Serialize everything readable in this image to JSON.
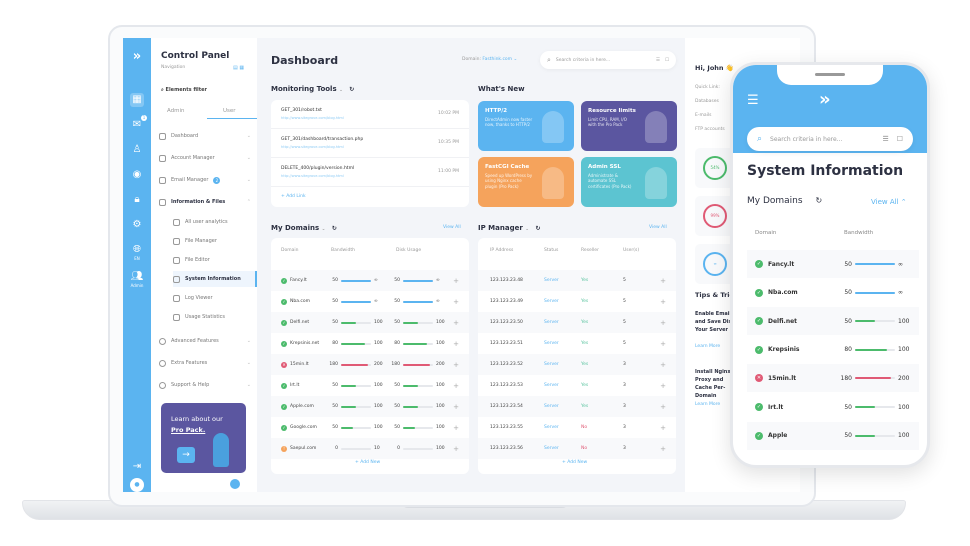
{
  "colors": {
    "accent": "#5bb4f0",
    "ok": "#4cbb6c",
    "error": "#e05a75",
    "warning": "#f5a35c",
    "purple": "#5b56a0"
  },
  "nav": {
    "title": "Control Panel",
    "subtitle": "Navigation",
    "filter": "Elements filter",
    "tabs": [
      "Admin",
      "User"
    ],
    "rail_labels": {
      "lang": "EN",
      "admin": "Admin"
    },
    "messages_badge": "1",
    "items": [
      {
        "label": "Dashboard",
        "icon": "dashboard-icon"
      },
      {
        "label": "Account Manager",
        "icon": "account-icon"
      },
      {
        "label": "Email Manager",
        "icon": "mail-icon",
        "badge": "2"
      },
      {
        "label": "Information & Files",
        "icon": "folder-icon"
      }
    ],
    "sub_items": [
      "All user analytics",
      "File Manager",
      "File Editor",
      "System Information",
      "Log Viewer",
      "Usage Statistics"
    ],
    "more_items": [
      "Advanced Features",
      "Extra Features",
      "Support & Help"
    ],
    "promo": {
      "line1": "Learn about our",
      "line2": "Pro Pack."
    }
  },
  "header": {
    "title": "Dashboard",
    "domain_label": "Domain:",
    "domain_value": "Fasthink.com",
    "search_placeholder": "Search criteria in here..."
  },
  "monitoring": {
    "title": "Monitoring Tools",
    "add_label": "Add Link",
    "items": [
      {
        "path": "GET_301/robot.txt",
        "url": "http://www.sitegrove.com/blog.html",
        "time": "10:02 PM"
      },
      {
        "path": "GET_301/dashboard/transaction.php",
        "url": "http://www.sitegrove.com/blog.html",
        "time": "10:35 PM"
      },
      {
        "path": "DELETE_400/plugin/version.html",
        "url": "http://www.sitegrove.com/blog.html",
        "time": "11:00 PM"
      }
    ]
  },
  "whats_new": {
    "title": "What's New",
    "cards": [
      {
        "title": "HTTP/2",
        "text": "DirectAdmin now faster now, thanks to HTTP/2",
        "color": "#5bb4f0"
      },
      {
        "title": "Resource limits",
        "text": "Limit CPU, RAM, I/O with the Pro Pack",
        "color": "#5b56a0"
      },
      {
        "title": "FastCGI Cache",
        "text": "Speed up WordPress by using Nginx cache plugin (Pro Pack)",
        "color": "#f5a35c"
      },
      {
        "title": "Admin SSL",
        "text": "Administrate & automate SSL certificates (Pro Pack)",
        "color": "#5cc4d1"
      }
    ]
  },
  "domains": {
    "title": "My Domains",
    "view_all": "View All",
    "add_label": "Add New",
    "columns": [
      "Domain",
      "Bandwidth",
      "Disk Usage"
    ],
    "rows": [
      {
        "name": "Fancy.lt",
        "status": "ok",
        "bw": "50",
        "bw_max": "∞",
        "bw_pct": 100,
        "disk": "50",
        "disk_max": "∞",
        "disk_pct": 100
      },
      {
        "name": "Nba.com",
        "status": "ok",
        "bw": "50",
        "bw_max": "∞",
        "bw_pct": 100,
        "disk": "50",
        "disk_max": "∞",
        "disk_pct": 100
      },
      {
        "name": "Delfi.net",
        "status": "ok",
        "bw": "50",
        "bw_max": "100",
        "bw_pct": 50,
        "disk": "50",
        "disk_max": "100",
        "disk_pct": 50
      },
      {
        "name": "Krepsinis.net",
        "status": "ok",
        "bw": "80",
        "bw_max": "100",
        "bw_pct": 80,
        "disk": "80",
        "disk_max": "100",
        "disk_pct": 80
      },
      {
        "name": "15min.lt",
        "status": "error",
        "bw": "180",
        "bw_max": "200",
        "bw_pct": 90,
        "disk": "180",
        "disk_max": "200",
        "disk_pct": 90
      },
      {
        "name": "Irt.lt",
        "status": "ok",
        "bw": "50",
        "bw_max": "100",
        "bw_pct": 50,
        "disk": "50",
        "disk_max": "100",
        "disk_pct": 50
      },
      {
        "name": "Apple.com",
        "status": "ok",
        "bw": "50",
        "bw_max": "100",
        "bw_pct": 50,
        "disk": "50",
        "disk_max": "100",
        "disk_pct": 50
      },
      {
        "name": "Google.com",
        "status": "ok",
        "bw": "50",
        "bw_max": "100",
        "bw_pct": 40,
        "disk": "50",
        "disk_max": "100",
        "disk_pct": 40
      },
      {
        "name": "Saepul.com",
        "status": "warning",
        "bw": "0",
        "bw_max": "10",
        "bw_pct": 0,
        "disk": "0",
        "disk_max": "100",
        "disk_pct": 0
      }
    ]
  },
  "ip": {
    "title": "IP Manager",
    "view_all": "View All",
    "add_label": "Add New",
    "columns": [
      "IP Address",
      "Status",
      "Reseller",
      "User(s)"
    ],
    "rows": [
      {
        "ip": "123.123.23.48",
        "status": "Server",
        "reseller": "Yes",
        "users": "5"
      },
      {
        "ip": "123.123.23.49",
        "status": "Server",
        "reseller": "Yes",
        "users": "5"
      },
      {
        "ip": "123.123.23.50",
        "status": "Server",
        "reseller": "Yes",
        "users": "5"
      },
      {
        "ip": "123.123.23.51",
        "status": "Server",
        "reseller": "Yes",
        "users": "5"
      },
      {
        "ip": "123.123.23.52",
        "status": "Server",
        "reseller": "Yes",
        "users": "3"
      },
      {
        "ip": "123.123.23.53",
        "status": "Server",
        "reseller": "Yes",
        "users": "3"
      },
      {
        "ip": "123.123.23.54",
        "status": "Server",
        "reseller": "Yes",
        "users": "3"
      },
      {
        "ip": "123.123.23.55",
        "status": "Server",
        "reseller": "No",
        "users": "3"
      },
      {
        "ip": "123.123.23.56",
        "status": "Server",
        "reseller": "No",
        "users": "3"
      }
    ]
  },
  "right": {
    "greeting": "Hi, John 👋",
    "quick_links": [
      "Quick Link:",
      "Databases",
      "E-mails",
      "FTP accounts"
    ],
    "rings": [
      {
        "label": "54%",
        "value": 54,
        "color": "#4cbb6c"
      },
      {
        "label": "99%",
        "value": 99,
        "color": "#e05a75"
      },
      {
        "label": "∞",
        "value": 100,
        "color": "#5bb4f0"
      }
    ],
    "tips_title": "Tips & Tricks",
    "tips": [
      {
        "text": "Enable Email and Save Disk Your Server",
        "link": "Learn More"
      },
      {
        "text": "Install Nginx Proxy and Cache Per-Domain",
        "link": "Learn More"
      }
    ]
  },
  "phone": {
    "search_placeholder": "Search criteria in here...",
    "title": "System Information",
    "section": "My Domains",
    "view_all": "View All",
    "columns": [
      "Domain",
      "Bandwidth"
    ],
    "rows": [
      {
        "name": "Fancy.lt",
        "status": "ok",
        "bw": "50",
        "max": "∞",
        "pct": 100
      },
      {
        "name": "Nba.com",
        "status": "ok",
        "bw": "50",
        "max": "∞",
        "pct": 100
      },
      {
        "name": "Delfi.net",
        "status": "ok",
        "bw": "50",
        "max": "100",
        "pct": 50
      },
      {
        "name": "Krepsinis",
        "status": "ok",
        "bw": "80",
        "max": "100",
        "pct": 80
      },
      {
        "name": "15min.lt",
        "status": "error",
        "bw": "180",
        "max": "200",
        "pct": 90
      },
      {
        "name": "Irt.lt",
        "status": "ok",
        "bw": "50",
        "max": "100",
        "pct": 50
      },
      {
        "name": "Apple",
        "status": "ok",
        "bw": "50",
        "max": "100",
        "pct": 50
      }
    ]
  }
}
